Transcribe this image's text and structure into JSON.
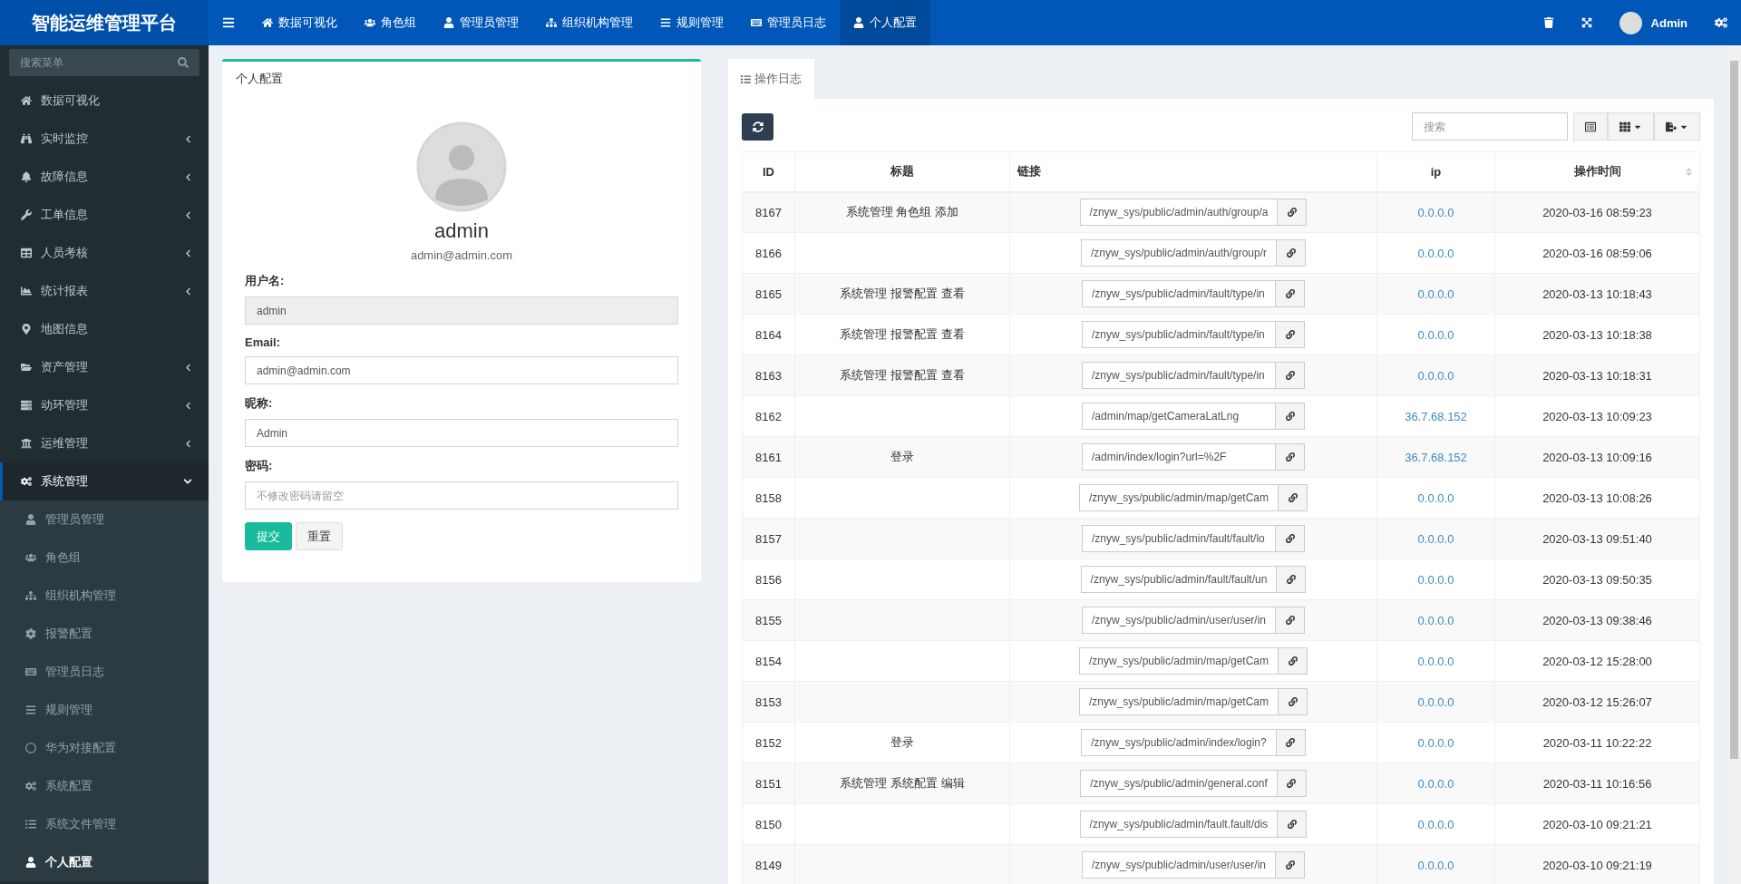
{
  "brand": "智能运维管理平台",
  "top_nav": [
    {
      "label": "数据可视化",
      "selected": false
    },
    {
      "label": "角色组",
      "selected": false
    },
    {
      "label": "管理员管理",
      "selected": false
    },
    {
      "label": "组织机构管理",
      "selected": false
    },
    {
      "label": "规则管理",
      "selected": false
    },
    {
      "label": "管理员日志",
      "selected": false
    },
    {
      "label": "个人配置",
      "selected": true
    }
  ],
  "header_user": {
    "name": "Admin"
  },
  "sidebar": {
    "search_placeholder": "搜索菜单",
    "items": [
      {
        "label": "数据可视化",
        "selected": false
      },
      {
        "label": "实时监控",
        "selected": false,
        "expanded": false
      },
      {
        "label": "故障信息",
        "selected": false,
        "expanded": false
      },
      {
        "label": "工单信息",
        "selected": false,
        "expanded": false
      },
      {
        "label": "人员考核",
        "selected": false,
        "expanded": false
      },
      {
        "label": "统计报表",
        "selected": false,
        "expanded": false
      },
      {
        "label": "地图信息",
        "selected": false
      },
      {
        "label": "资产管理",
        "selected": false,
        "expanded": false
      },
      {
        "label": "动环管理",
        "selected": false,
        "expanded": false
      },
      {
        "label": "运维管理",
        "selected": false,
        "expanded": false
      },
      {
        "label": "系统管理",
        "selected": true,
        "expanded": true,
        "children": [
          {
            "label": "管理员管理",
            "selected": false
          },
          {
            "label": "角色组",
            "selected": false
          },
          {
            "label": "组织机构管理",
            "selected": false
          },
          {
            "label": "报警配置",
            "selected": false
          },
          {
            "label": "管理员日志",
            "selected": false
          },
          {
            "label": "规则管理",
            "selected": false
          },
          {
            "label": "华为对接配置",
            "selected": false
          },
          {
            "label": "系统配置",
            "selected": false
          },
          {
            "label": "系统文件管理",
            "selected": false
          },
          {
            "label": "个人配置",
            "selected": true
          }
        ]
      }
    ]
  },
  "profile_panel": {
    "title": "个人配置",
    "name": "admin",
    "email": "admin@admin.com",
    "fields": [
      {
        "label": "用户名:",
        "value": "admin",
        "disabled": true
      },
      {
        "label": "Email:",
        "value": "admin@admin.com",
        "disabled": false
      },
      {
        "label": "昵称:",
        "value": "Admin",
        "disabled": false
      },
      {
        "label": "密码:",
        "placeholder": "不修改密码请留空",
        "disabled": false
      }
    ],
    "buttons": [
      {
        "label": "提交",
        "kind": "primary"
      },
      {
        "label": "重置",
        "kind": "default"
      }
    ]
  },
  "log_panel": {
    "tab": "操作日志",
    "search_placeholder": "搜索",
    "table": {
      "columns": [
        {
          "label": "ID",
          "sortable": false
        },
        {
          "label": "标题",
          "sortable": false
        },
        {
          "label": "链接",
          "sortable": false
        },
        {
          "label": "ip",
          "sortable": false
        },
        {
          "label": "操作时间",
          "sortable": true
        }
      ],
      "rows": [
        {
          "id": "8167",
          "title": "系统管理 角色组 添加",
          "link": "/znyw_sys/public/admin/auth/group/a",
          "ip": "0.0.0.0",
          "time": "2020-03-16 08:59:23"
        },
        {
          "id": "8166",
          "title": "",
          "link": "/znyw_sys/public/admin/auth/group/r",
          "ip": "0.0.0.0",
          "time": "2020-03-16 08:59:06"
        },
        {
          "id": "8165",
          "title": "系统管理 报警配置 查看",
          "link": "/znyw_sys/public/admin/fault/type/in",
          "ip": "0.0.0.0",
          "time": "2020-03-13 10:18:43"
        },
        {
          "id": "8164",
          "title": "系统管理 报警配置 查看",
          "link": "/znyw_sys/public/admin/fault/type/in",
          "ip": "0.0.0.0",
          "time": "2020-03-13 10:18:38"
        },
        {
          "id": "8163",
          "title": "系统管理 报警配置 查看",
          "link": "/znyw_sys/public/admin/fault/type/in",
          "ip": "0.0.0.0",
          "time": "2020-03-13 10:18:31"
        },
        {
          "id": "8162",
          "title": "",
          "link": "/admin/map/getCameraLatLng",
          "ip": "36.7.68.152",
          "time": "2020-03-13 10:09:23"
        },
        {
          "id": "8161",
          "title": "登录",
          "link": "/admin/index/login?url=%2F",
          "ip": "36.7.68.152",
          "time": "2020-03-13 10:09:16"
        },
        {
          "id": "8158",
          "title": "",
          "link": "/znyw_sys/public/admin/map/getCam",
          "ip": "0.0.0.0",
          "time": "2020-03-13 10:08:26"
        },
        {
          "id": "8157",
          "title": "",
          "link": "/znyw_sys/public/admin/fault/fault/lo",
          "ip": "0.0.0.0",
          "time": "2020-03-13 09:51:40"
        },
        {
          "id": "8156",
          "title": "",
          "link": "/znyw_sys/public/admin/fault/fault/un",
          "ip": "0.0.0.0",
          "time": "2020-03-13 09:50:35"
        },
        {
          "id": "8155",
          "title": "",
          "link": "/znyw_sys/public/admin/user/user/in",
          "ip": "0.0.0.0",
          "time": "2020-03-13 09:38:46"
        },
        {
          "id": "8154",
          "title": "",
          "link": "/znyw_sys/public/admin/map/getCam",
          "ip": "0.0.0.0",
          "time": "2020-03-12 15:28:00"
        },
        {
          "id": "8153",
          "title": "",
          "link": "/znyw_sys/public/admin/map/getCam",
          "ip": "0.0.0.0",
          "time": "2020-03-12 15:26:07"
        },
        {
          "id": "8152",
          "title": "登录",
          "link": "/znyw_sys/public/admin/index/login?",
          "ip": "0.0.0.0",
          "time": "2020-03-11 10:22:22"
        },
        {
          "id": "8151",
          "title": "系统管理 系统配置 编辑",
          "link": "/znyw_sys/public/admin/general.conf",
          "ip": "0.0.0.0",
          "time": "2020-03-11 10:16:56"
        },
        {
          "id": "8150",
          "title": "",
          "link": "/znyw_sys/public/admin/fault.fault/dis",
          "ip": "0.0.0.0",
          "time": "2020-03-10 09:21:21"
        },
        {
          "id": "8149",
          "title": "",
          "link": "/znyw_sys/public/admin/user/user/in",
          "ip": "0.0.0.0",
          "time": "2020-03-10 09:21:19"
        }
      ]
    }
  }
}
